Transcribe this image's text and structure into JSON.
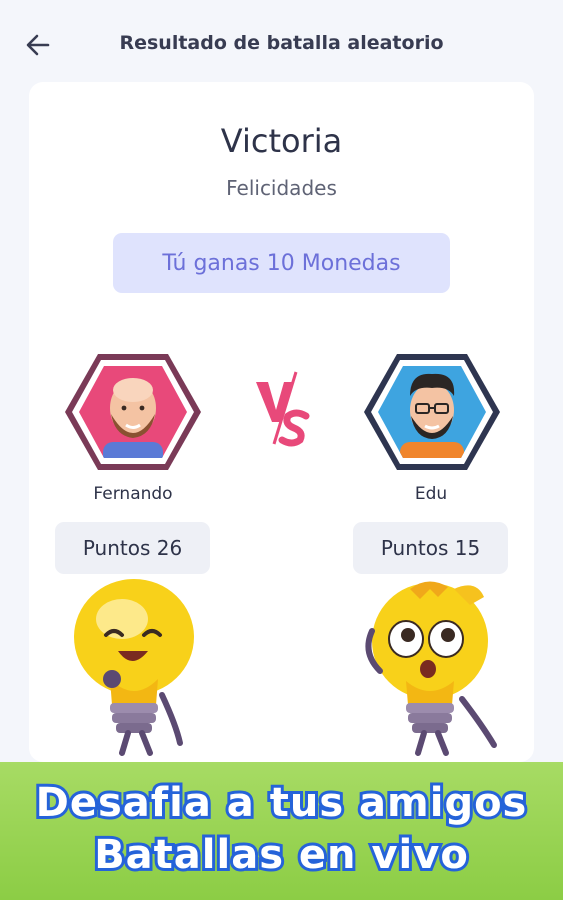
{
  "header": {
    "title": "Resultado de batalla aleatorio",
    "back_icon": "arrow-left-icon"
  },
  "result": {
    "heading": "Victoria",
    "subheading": "Felicidades",
    "reward": "Tú ganas 10 Monedas"
  },
  "players": [
    {
      "name": "Fernando",
      "score": "Puntos 26",
      "frame_color": "#e8497a"
    },
    {
      "name": "Edu",
      "score": "Puntos 15",
      "frame_color": "#3b4560"
    }
  ],
  "versus_icon": "vs-icon",
  "banner": {
    "line1": "Desafia a tus amigos",
    "line2": "Batallas en vivo"
  },
  "colors": {
    "accent": "#6c70d9",
    "banner_green": "#95d14e",
    "banner_text_outline": "#2563d9"
  }
}
